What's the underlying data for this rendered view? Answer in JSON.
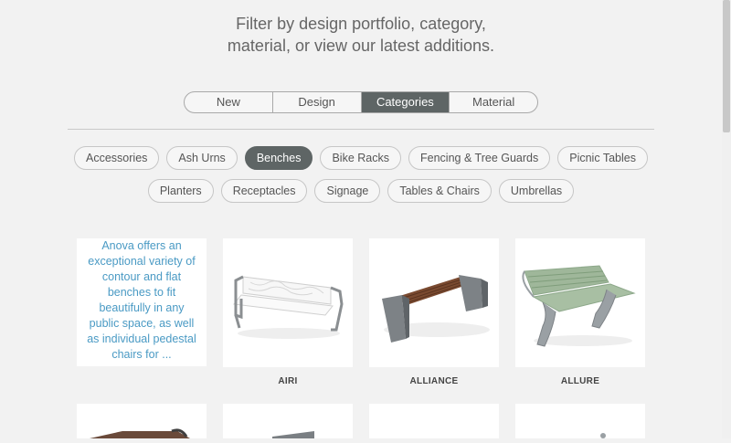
{
  "intro": {
    "line1": "Filter by design portfolio, category,",
    "line2": "material, or view our latest additions."
  },
  "filter_tabs": [
    {
      "label": "New",
      "active": false
    },
    {
      "label": "Design",
      "active": false
    },
    {
      "label": "Categories",
      "active": true
    },
    {
      "label": "Material",
      "active": false
    }
  ],
  "categories_row1": [
    {
      "label": "Accessories",
      "active": false
    },
    {
      "label": "Ash Urns",
      "active": false
    },
    {
      "label": "Benches",
      "active": true
    },
    {
      "label": "Bike Racks",
      "active": false
    },
    {
      "label": "Fencing & Tree Guards",
      "active": false
    },
    {
      "label": "Picnic Tables",
      "active": false
    }
  ],
  "categories_row2": [
    {
      "label": "Planters",
      "active": false
    },
    {
      "label": "Receptacles",
      "active": false
    },
    {
      "label": "Signage",
      "active": false
    },
    {
      "label": "Tables & Chairs",
      "active": false
    },
    {
      "label": "Umbrellas",
      "active": false
    }
  ],
  "description": "Anova offers an exceptional variety of contour and flat benches to fit beautifully in any public space, as well as individual pedestal chairs for ...",
  "products": [
    {
      "name": "AIRI",
      "icon": "white-bench-image"
    },
    {
      "name": "ALLIANCE",
      "icon": "wood-backless-bench-image"
    },
    {
      "name": "ALLURE",
      "icon": "green-contour-bench-image"
    }
  ],
  "colors": {
    "active": "#5e6565",
    "accent_text": "#4a9ac4",
    "background": "#f2f2f2"
  }
}
